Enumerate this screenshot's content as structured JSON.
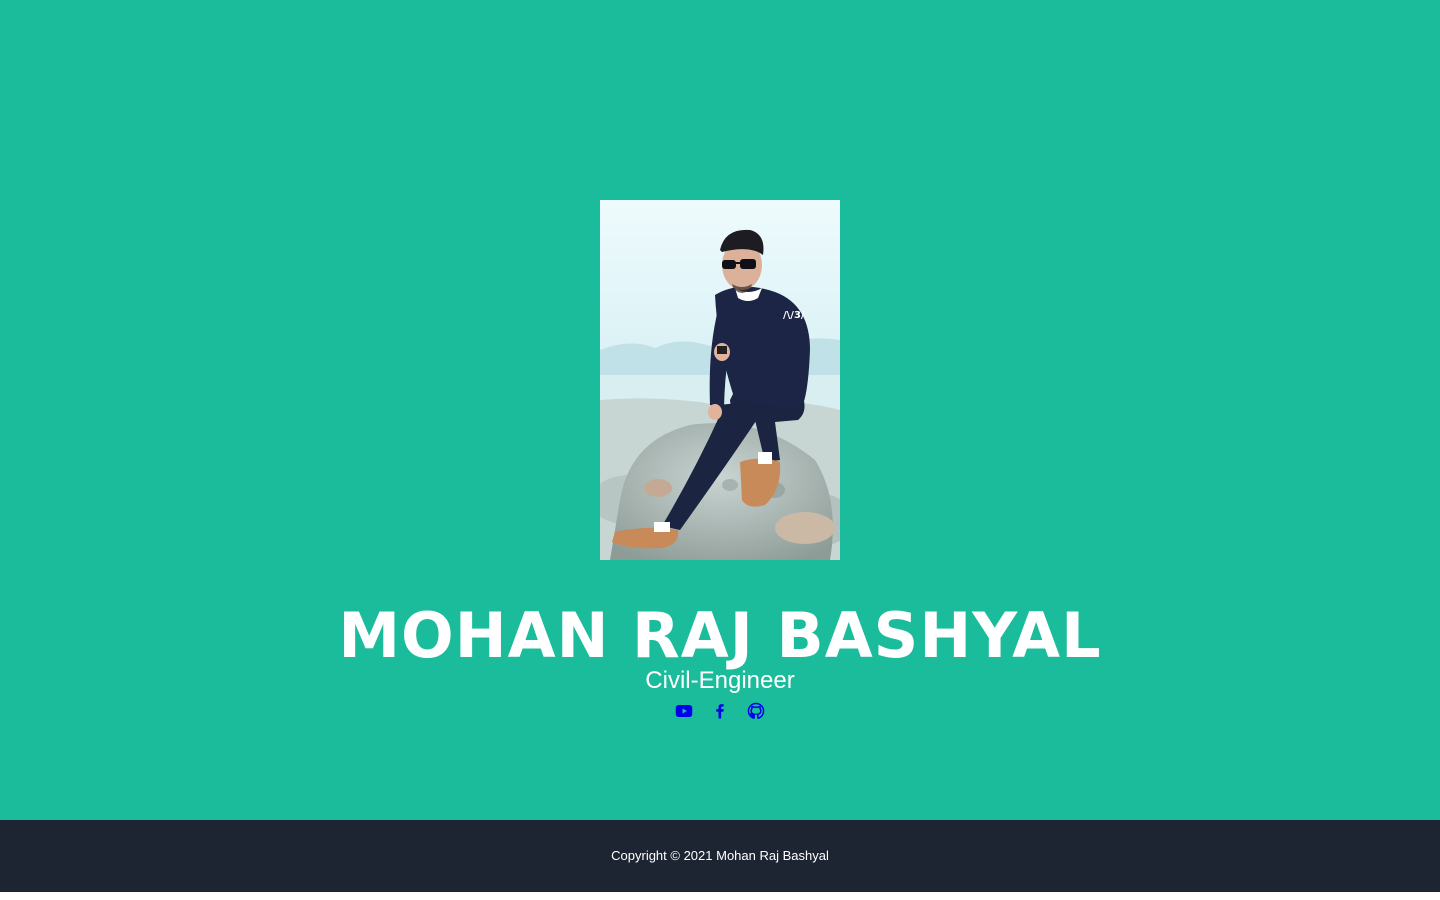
{
  "profile": {
    "name": "MOHAN RAJ BASHYAL",
    "title": "Civil-Engineer",
    "photo_alt": "Mohan Raj Bashyal"
  },
  "social": [
    {
      "icon": "youtube-icon"
    },
    {
      "icon": "facebook-icon"
    },
    {
      "icon": "github-icon"
    }
  ],
  "footer": {
    "copyright": "Copyright © 2021 Mohan Raj Bashyal"
  },
  "colors": {
    "masthead_bg": "#1abc9c",
    "footer_bg": "#1e2532",
    "link": "#0000ee",
    "text": "#ffffff"
  }
}
